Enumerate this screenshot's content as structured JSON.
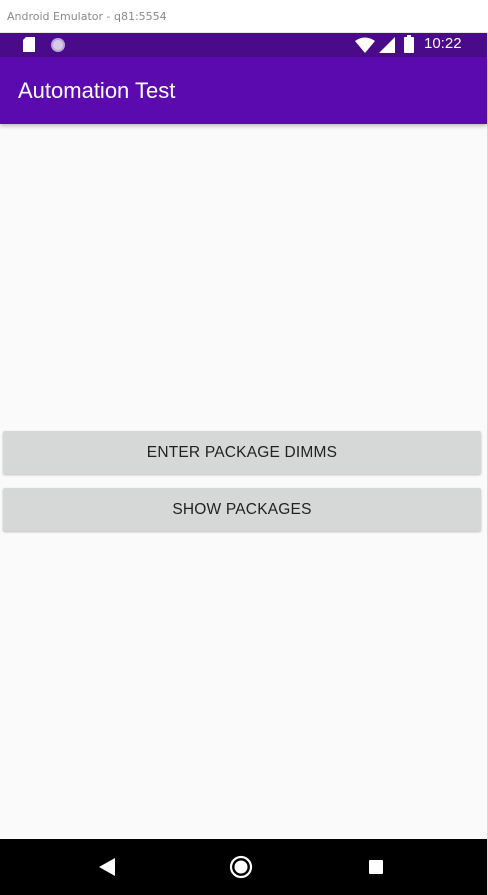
{
  "window": {
    "title": "Android Emulator - q81:5554"
  },
  "status_bar": {
    "time": "10:22",
    "background": "#4a0b8a",
    "icons": [
      "sd-card-icon",
      "sync-circle-icon",
      "wifi-icon",
      "cell-signal-icon",
      "battery-icon"
    ]
  },
  "app_bar": {
    "title": "Automation Test",
    "background": "#5b0ab0"
  },
  "main": {
    "buttons": [
      {
        "label": "ENTER PACKAGE DIMMS"
      },
      {
        "label": "SHOW PACKAGES"
      }
    ],
    "button_color": "#d6d7d7"
  },
  "nav_bar": {
    "icons": [
      "back-icon",
      "home-icon",
      "recents-icon"
    ]
  }
}
